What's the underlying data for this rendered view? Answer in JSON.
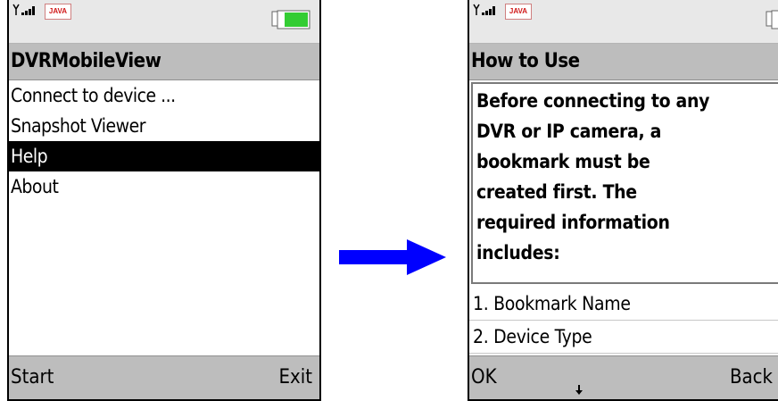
{
  "left_screen": {
    "status": {
      "java_badge": "JAVA",
      "icons": [
        "signal-icon",
        "java-icon",
        "battery-icon"
      ]
    },
    "title": "DVRMobileView",
    "menu": [
      {
        "label": "Connect to device ..."
      },
      {
        "label": "Snapshot Viewer"
      },
      {
        "label": "Help",
        "selected": true
      },
      {
        "label": "About"
      }
    ],
    "softkeys": {
      "left": "Start",
      "right": "Exit"
    }
  },
  "transition": {
    "icon": "arrow-right-icon",
    "color": "#0000ff"
  },
  "right_screen": {
    "status": {
      "java_badge": "JAVA",
      "icons": [
        "signal-icon",
        "java-icon",
        "battery-icon"
      ]
    },
    "title": "How to Use",
    "intro_lines": [
      "Before connecting to any",
      "DVR or IP camera, a",
      "bookmark must be",
      "created first. The",
      "required information",
      "includes:"
    ],
    "items": [
      "1. Bookmark Name",
      "2. Device Type"
    ],
    "softkeys": {
      "left": "OK",
      "right": "Back"
    },
    "scroll_icon": "scroll-down-icon"
  },
  "colors": {
    "battery": "#33cc33",
    "java_badge": "#d01818",
    "selection": "#000000",
    "bars": "#bdbdbd"
  }
}
